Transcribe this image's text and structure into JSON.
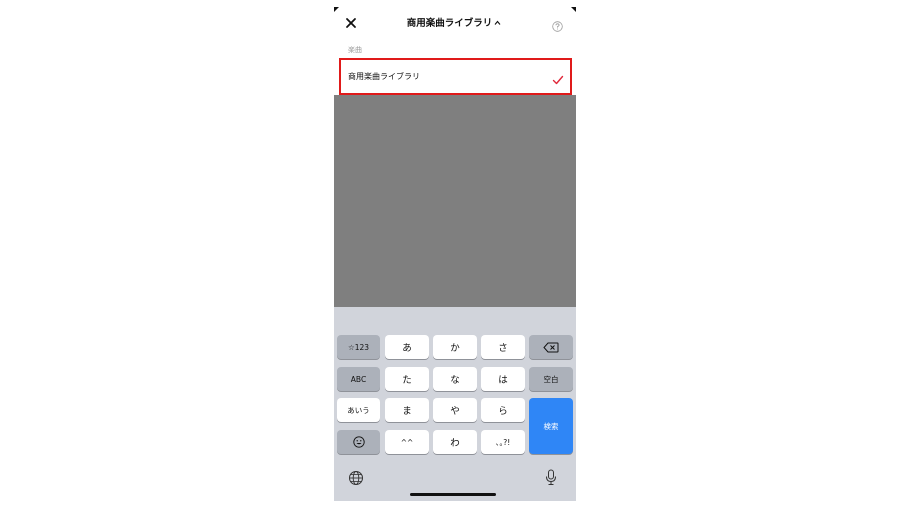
{
  "header": {
    "title": "商用楽曲ライブラリ",
    "title_chevron": "^",
    "close_icon": "close-icon",
    "help_icon": "question-circle-icon"
  },
  "section_label": "楽曲",
  "list": {
    "items": [
      {
        "label": "商用楽曲ライブラリ",
        "selected": true
      }
    ],
    "check_color": "#e0283a",
    "highlight_color": "#e01a1a"
  },
  "keyboard": {
    "row1": [
      "☆123",
      "あ",
      "か",
      "さ"
    ],
    "row2": [
      "ABC",
      "た",
      "な",
      "は",
      "空白"
    ],
    "row3": [
      "あいう",
      "ま",
      "や",
      "ら"
    ],
    "row4": [
      "^^",
      "わ",
      "､｡?!"
    ],
    "search_label": "検索",
    "accent_color": "#2f86f6"
  }
}
